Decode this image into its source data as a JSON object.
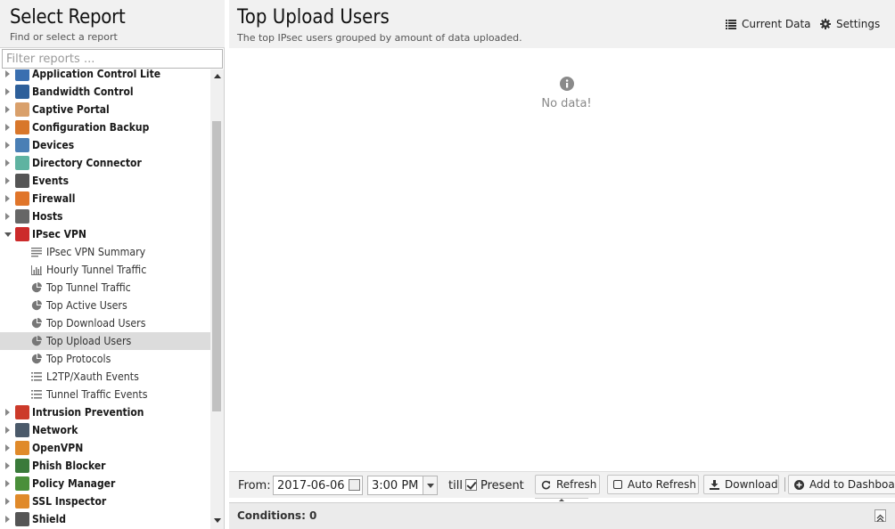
{
  "left": {
    "title": "Select Report",
    "subtitle": "Find or select a report",
    "filter_placeholder": "Filter reports ..."
  },
  "tree": [
    {
      "type": "cat",
      "label": "Application Control Lite",
      "icon": "app-control-lite-icon",
      "color": "#3a6fb0",
      "state": "collapsed"
    },
    {
      "type": "cat",
      "label": "Bandwidth Control",
      "icon": "bandwidth-control-icon",
      "color": "#2d5f9a",
      "state": "collapsed"
    },
    {
      "type": "cat",
      "label": "Captive Portal",
      "icon": "captive-portal-icon",
      "color": "#d9a06b",
      "state": "collapsed"
    },
    {
      "type": "cat",
      "label": "Configuration Backup",
      "icon": "config-backup-icon",
      "color": "#d8772b",
      "state": "collapsed"
    },
    {
      "type": "cat",
      "label": "Devices",
      "icon": "devices-icon",
      "color": "#4a7fb5",
      "state": "collapsed"
    },
    {
      "type": "cat",
      "label": "Directory Connector",
      "icon": "directory-connector-icon",
      "color": "#5fb3a1",
      "state": "collapsed"
    },
    {
      "type": "cat",
      "label": "Events",
      "icon": "events-icon",
      "color": "#555555",
      "state": "collapsed"
    },
    {
      "type": "cat",
      "label": "Firewall",
      "icon": "firewall-icon",
      "color": "#e0752a",
      "state": "collapsed"
    },
    {
      "type": "cat",
      "label": "Hosts",
      "icon": "hosts-icon",
      "color": "#666666",
      "state": "collapsed"
    },
    {
      "type": "cat",
      "label": "IPsec VPN",
      "icon": "lock-icon",
      "color": "#cc2a2a",
      "state": "expanded"
    },
    {
      "type": "child",
      "label": "IPsec VPN Summary",
      "icon": "text-lines-icon"
    },
    {
      "type": "child",
      "label": "Hourly Tunnel Traffic",
      "icon": "bar-chart-icon"
    },
    {
      "type": "child",
      "label": "Top Tunnel Traffic",
      "icon": "pie-chart-icon"
    },
    {
      "type": "child",
      "label": "Top Active Users",
      "icon": "pie-chart-icon"
    },
    {
      "type": "child",
      "label": "Top Download Users",
      "icon": "pie-chart-icon"
    },
    {
      "type": "child",
      "label": "Top Upload Users",
      "icon": "pie-chart-icon",
      "selected": true
    },
    {
      "type": "child",
      "label": "Top Protocols",
      "icon": "pie-chart-icon"
    },
    {
      "type": "child",
      "label": "L2TP/Xauth Events",
      "icon": "list-icon"
    },
    {
      "type": "child",
      "label": "Tunnel Traffic Events",
      "icon": "list-icon"
    },
    {
      "type": "cat",
      "label": "Intrusion Prevention",
      "icon": "intrusion-prevention-icon",
      "color": "#cc3a2a",
      "state": "collapsed"
    },
    {
      "type": "cat",
      "label": "Network",
      "icon": "network-icon",
      "color": "#4b5a6a",
      "state": "collapsed"
    },
    {
      "type": "cat",
      "label": "OpenVPN",
      "icon": "openvpn-icon",
      "color": "#e08a2a",
      "state": "collapsed"
    },
    {
      "type": "cat",
      "label": "Phish Blocker",
      "icon": "phish-blocker-icon",
      "color": "#3a7a3a",
      "state": "collapsed"
    },
    {
      "type": "cat",
      "label": "Policy Manager",
      "icon": "policy-manager-icon",
      "color": "#4a8f3a",
      "state": "collapsed"
    },
    {
      "type": "cat",
      "label": "SSL Inspector",
      "icon": "ssl-inspector-icon",
      "color": "#e08a2a",
      "state": "collapsed"
    },
    {
      "type": "cat",
      "label": "Shield",
      "icon": "shield-icon",
      "color": "#555555",
      "state": "collapsed"
    }
  ],
  "report": {
    "title": "Top Upload Users",
    "subtitle": "The top IPsec users grouped by amount of data uploaded.",
    "current_data_label": "Current Data",
    "settings_label": "Settings",
    "no_data_text": "No data!"
  },
  "toolbar": {
    "from_label": "From:",
    "date_value": "2017-06-06",
    "time_value": "3:00 PM",
    "till_label": "till",
    "present_label": "Present",
    "refresh_label": "Refresh",
    "auto_refresh_label": "Auto Refresh",
    "download_label": "Download",
    "add_dashboard_label": "Add to Dashboard"
  },
  "conditions": {
    "label": "Conditions: 0"
  }
}
